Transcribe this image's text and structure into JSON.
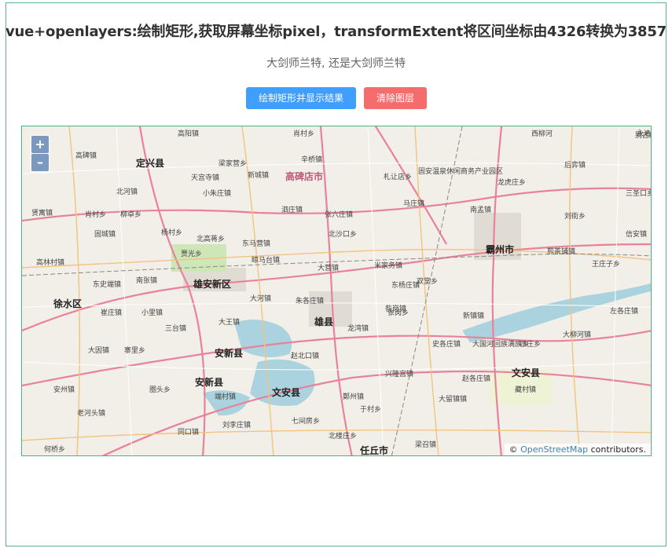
{
  "header": {
    "title": "vue+openlayers:绘制矩形,获取屏幕坐标pixel，transformExtent将区间坐标由4326转换为3857",
    "subtitle": "大剑师兰特, 还是大剑师兰特"
  },
  "toolbar": {
    "draw_label": "绘制矩形并显示结果",
    "clear_label": "清除图层"
  },
  "map": {
    "zoom_in": "+",
    "zoom_out": "–",
    "attribution": {
      "prefix": "©",
      "link_text": "OpenStreetMap",
      "suffix": "contributors."
    },
    "places": [
      "高阳镇",
      "肖村乡",
      "西柳河",
      "永清镇",
      "别古庄",
      "高碑镇",
      "定兴县",
      "梁家营乡",
      "辛桥镇",
      "后弈镇",
      "北河镇",
      "天宫寺镇",
      "新城镇",
      "高碑店市",
      "札让店乡",
      "固安温泉休闲商务产业园区",
      "小朱庄镇",
      "龙虎庄乡",
      "三圣口乡",
      "贤寓镇",
      "肖村乡",
      "柳卓乡",
      "泗庄镇",
      "张六庄镇",
      "马庄镇",
      "南孟镇",
      "刘街乡",
      "固城镇",
      "杨村乡",
      "北高蒋乡",
      "东马营镇",
      "北沙口乡",
      "信安镇",
      "贾光乡",
      "高林村镇",
      "晾马台镇",
      "大营镇",
      "霸州市",
      "煎茶铺镇",
      "王庄子乡",
      "东史端镇",
      "南张镇",
      "雄安新区",
      "米家务镇",
      "双堂乡",
      "东杨庄镇",
      "徐水区",
      "大河镇",
      "朱各庄镇",
      "昝岗镇",
      "崔庄镇",
      "小里镇",
      "雄县",
      "张岗乡",
      "新镇镇",
      "左各庄镇",
      "三台镇",
      "大王镇",
      "龙湾镇",
      "大柳河镇",
      "大因镇",
      "寨里乡",
      "安新县",
      "赵北口镇",
      "史各庄镇",
      "大国河回族满族乡",
      "四庄乡",
      "安新县",
      "兴隆宫镇",
      "赵各庄镇",
      "文安县",
      "藏村镇",
      "安州镇",
      "圈头乡",
      "文安县",
      "端村镇",
      "鄚州镇",
      "大留镇镇",
      "老河头镇",
      "于村乡",
      "同口镇",
      "刘李庄镇",
      "七间房乡",
      "北楼庄乡",
      "何桥乡",
      "梁召镇",
      "任丘市"
    ]
  }
}
